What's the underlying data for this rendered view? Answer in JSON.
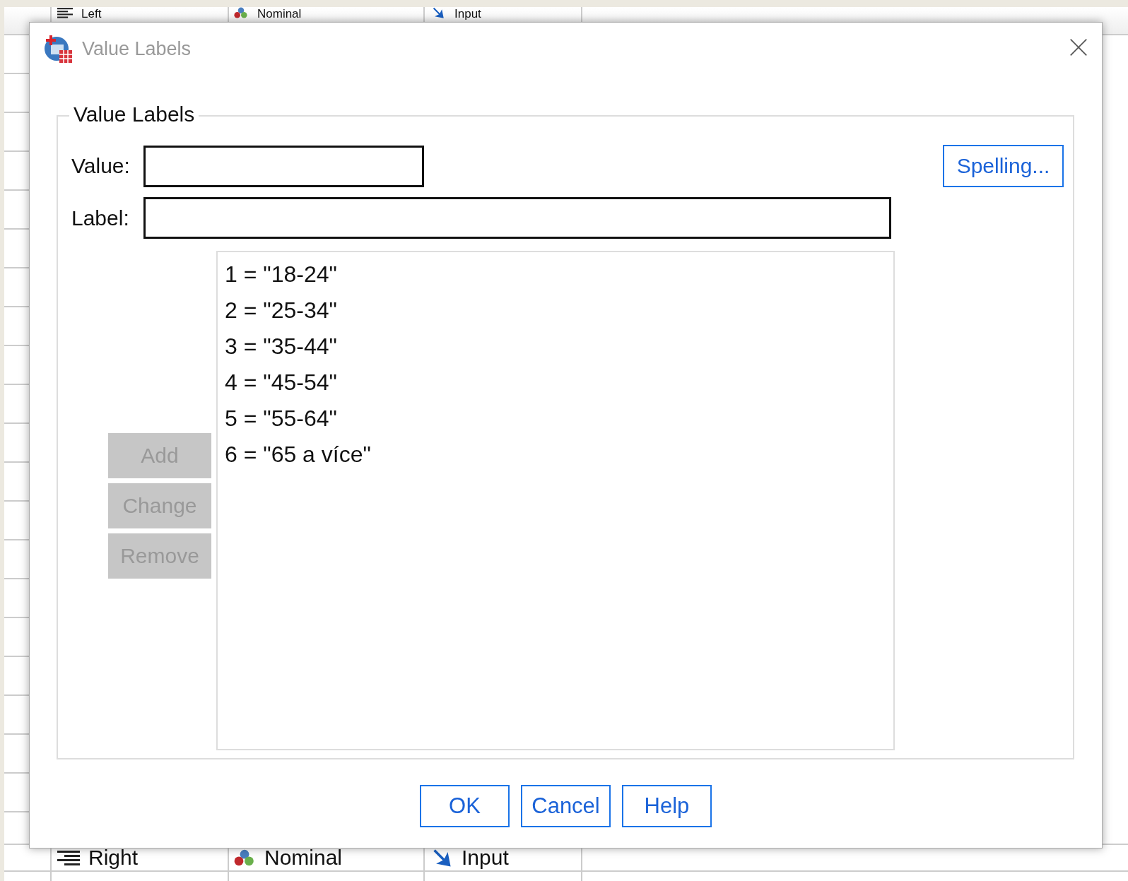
{
  "background_grid": {
    "rows": [
      {
        "align": {
          "kind": "left",
          "label": "Left"
        },
        "measure": "Nominal",
        "role": "Input"
      },
      {
        "align": {
          "kind": "right",
          "label": "Right"
        },
        "measure": "Nominal",
        "role": "Input"
      }
    ]
  },
  "dialog": {
    "title": "Value Labels",
    "group_title": "Value Labels",
    "value_field": {
      "label": "Value:"
    },
    "label_field": {
      "label": "Label:"
    },
    "spelling_button": "Spelling...",
    "side_buttons": [
      {
        "label": "Add",
        "disabled": true
      },
      {
        "label": "Change",
        "disabled": true
      },
      {
        "label": "Remove",
        "disabled": true
      }
    ],
    "labels_list": [
      {
        "text": "1 = \"18-24\"",
        "selected": false
      },
      {
        "text": "2 = \"25-34\"",
        "selected": false
      },
      {
        "text": "3 = \"35-44\"",
        "selected": false
      },
      {
        "text": "4 = \"45-54\"",
        "selected": false
      },
      {
        "text": "5 = \"55-64\"",
        "selected": false
      },
      {
        "text": "6 = \"65 a více\"",
        "selected": false
      }
    ],
    "buttons": [
      "OK",
      "Cancel",
      "Help"
    ]
  }
}
